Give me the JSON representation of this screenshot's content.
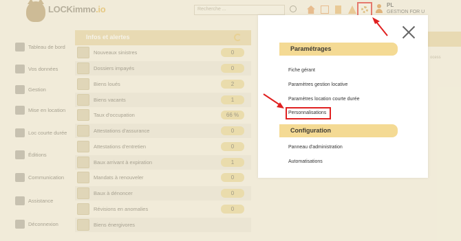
{
  "header": {
    "logo_text_main": "LOCKimmo",
    "logo_text_suffix": ".io",
    "logo_sub": "",
    "search_placeholder": "Recherche ...",
    "user_name": "PL",
    "user_company": "GESTION FOR U"
  },
  "sidebar": {
    "items": [
      {
        "label": "Tableau de bord",
        "icon": "key-icon"
      },
      {
        "label": "Vos données",
        "icon": "person-icon"
      },
      {
        "label": "Gestion",
        "icon": "people-icon"
      },
      {
        "label": "Mise en location",
        "icon": "key-icon"
      },
      {
        "label": "Loc courte durée",
        "icon": "suitcase-icon"
      },
      {
        "label": "Éditions",
        "icon": "document-icon"
      },
      {
        "label": "Communication",
        "icon": "chat-icon"
      },
      {
        "label": "Assistance",
        "icon": "support-icon"
      },
      {
        "label": "Déconnexion",
        "icon": "logout-icon"
      }
    ]
  },
  "panel": {
    "title": "Infos et alertes",
    "rows": [
      {
        "label": "Nouveaux sinistres",
        "value": "0"
      },
      {
        "label": "Dossiers impayés",
        "value": "0"
      },
      {
        "label": "Biens loués",
        "value": "2"
      },
      {
        "label": "Biens vacants",
        "value": "1"
      },
      {
        "label": "Taux d'occupation",
        "value": "66 %"
      },
      {
        "label": "Attestations d'assurance",
        "value": "0"
      },
      {
        "label": "Attestations d'entretien",
        "value": "0"
      },
      {
        "label": "Baux arrivant à expiration",
        "value": "1"
      },
      {
        "label": "Mandats à renouveler",
        "value": "0"
      },
      {
        "label": "Baux à dénoncer",
        "value": "0"
      },
      {
        "label": "Révisions en anomalies",
        "value": "0"
      },
      {
        "label": "Biens énergivores",
        "value": ""
      }
    ]
  },
  "right": {
    "partial_text": "ocess"
  },
  "modal": {
    "section1": {
      "title": "Paramétrages",
      "links": [
        "Fiche gérant",
        "Paramètres gestion locative",
        "Paramètres location courte durée",
        "Personnalisations"
      ]
    },
    "section2": {
      "title": "Configuration",
      "links": [
        "Panneau d'administration",
        "Automatisations"
      ]
    }
  },
  "colors": {
    "accent": "#f4da94",
    "highlight": "#e02020",
    "panel_header": "#e5d29e",
    "badge": "#e9d592"
  }
}
